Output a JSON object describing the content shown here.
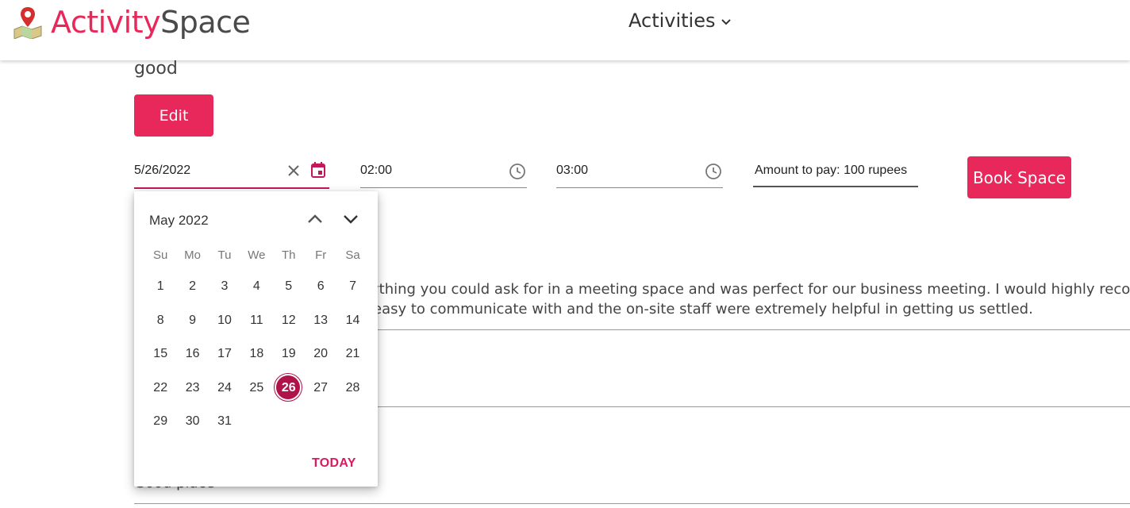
{
  "header": {
    "logo_part1": "Activity",
    "logo_part2": "Space",
    "nav_label": "Activities"
  },
  "content": {
    "review_title": "good",
    "edit_label": "Edit",
    "review_line1": "ything you could ask for in a meeting space and was perfect for our business meeting. I would highly recommend",
    "review_line2": "easy to communicate with and the on-site staff were extremely helpful in getting us settled.",
    "review_partial": "Good place"
  },
  "booking": {
    "date_value": "5/26/2022",
    "start_time": "02:00",
    "end_time": "03:00",
    "amount_text": "Amount to pay: 100 rupees",
    "book_label": "Book Space"
  },
  "calendar": {
    "month_label": "May 2022",
    "weekdays": [
      "Su",
      "Mo",
      "Tu",
      "We",
      "Th",
      "Fr",
      "Sa"
    ],
    "weeks": [
      [
        "1",
        "2",
        "3",
        "4",
        "5",
        "6",
        "7"
      ],
      [
        "8",
        "9",
        "10",
        "11",
        "12",
        "13",
        "14"
      ],
      [
        "15",
        "16",
        "17",
        "18",
        "19",
        "20",
        "21"
      ],
      [
        "22",
        "23",
        "24",
        "25",
        "26",
        "27",
        "28"
      ],
      [
        "29",
        "30",
        "31",
        "",
        "",
        "",
        ""
      ]
    ],
    "selected_day": "26",
    "today_label": "TODAY"
  },
  "colors": {
    "brand": "#e8285a",
    "selected_day": "#b0124a",
    "today_text": "#d81b60"
  }
}
